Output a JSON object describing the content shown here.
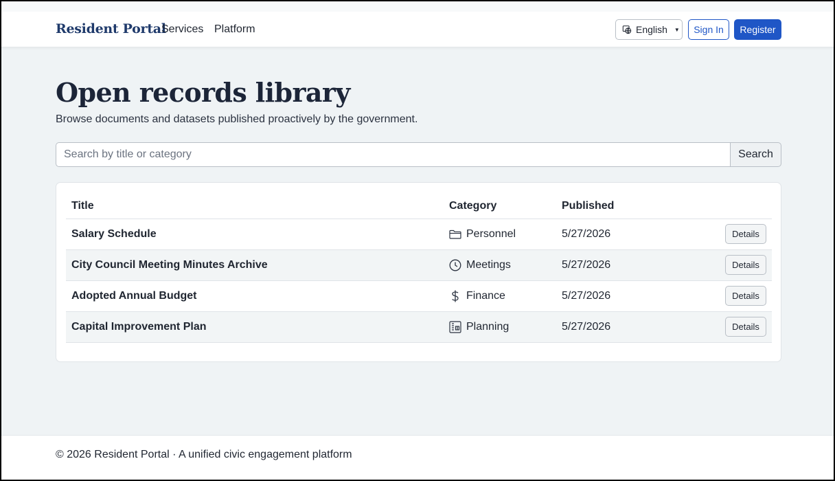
{
  "header": {
    "brand": "Resident Portal",
    "nav": [
      "Services",
      "Platform"
    ],
    "language": "English",
    "sign_in": "Sign In",
    "register": "Register",
    "accent_color": "#1f56c6"
  },
  "main": {
    "title": "Open records library",
    "subtitle": "Browse documents and datasets published proactively by the government.",
    "search": {
      "placeholder": "Search by title or category",
      "value": "",
      "button": "Search"
    },
    "table": {
      "columns": [
        "Title",
        "Category",
        "Published",
        ""
      ],
      "rows": [
        {
          "title": "Salary Schedule",
          "category": "Personnel",
          "icon": "folder-icon",
          "published": "5/27/2026",
          "action": "Details"
        },
        {
          "title": "City Council Meeting Minutes Archive",
          "category": "Meetings",
          "icon": "clock-icon",
          "published": "5/27/2026",
          "action": "Details"
        },
        {
          "title": "Adopted Annual Budget",
          "category": "Finance",
          "icon": "dollar-icon",
          "published": "5/27/2026",
          "action": "Details"
        },
        {
          "title": "Capital Improvement Plan",
          "category": "Planning",
          "icon": "building-icon",
          "published": "5/27/2026",
          "action": "Details"
        }
      ]
    }
  },
  "footer": {
    "text": "© 2026 Resident Portal · A unified civic engagement platform"
  }
}
